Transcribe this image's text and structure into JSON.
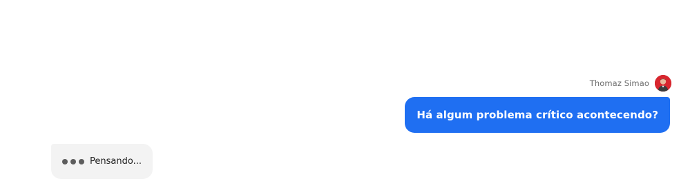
{
  "user_message": {
    "author_name": "Thomaz Simao",
    "avatar_icon": "user-avatar-photo",
    "text": "Há algum problema crítico acontecendo?",
    "bubble_color": "#1f6ff2"
  },
  "assistant_status": {
    "indicator_icon": "typing-dots-icon",
    "label": "Pensando..."
  }
}
